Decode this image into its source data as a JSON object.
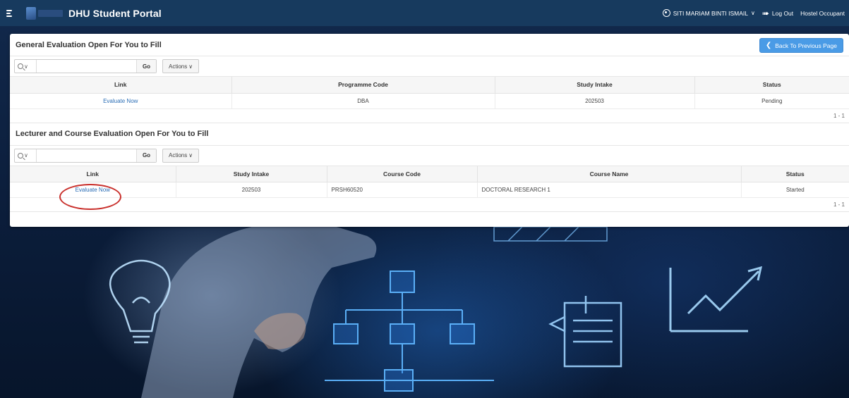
{
  "topbar": {
    "title": "DHU Student Portal",
    "user_name": "SITI MARIAM BINTI ISMAIL",
    "logout_label": "Log Out",
    "hostel_label": "Hostel Occupant",
    "bg_color": "#173a5e"
  },
  "general": {
    "title": "General Evaluation Open For You to Fill",
    "back_button": "Back To Previous Page",
    "go_label": "Go",
    "actions_label": "Actions",
    "columns": [
      "Link",
      "Programme Code",
      "Study Intake",
      "Status"
    ],
    "rows": [
      {
        "link": "Evaluate Now",
        "programme_code": "DBA",
        "study_intake": "202503",
        "status": "Pending"
      }
    ],
    "pagination": "1 - 1"
  },
  "lecturer": {
    "title": "Lecturer and Course Evaluation Open For You to Fill",
    "go_label": "Go",
    "actions_label": "Actions",
    "columns": [
      "Link",
      "Study Intake",
      "Course Code",
      "Course Name",
      "Status"
    ],
    "rows": [
      {
        "link": "Evaluate Now",
        "study_intake": "202503",
        "course_code": "PRSH60520",
        "course_name": "DOCTORAL RESEARCH 1",
        "status": "Started"
      }
    ],
    "pagination": "1 - 1"
  },
  "icons": {
    "menu": "hamburger-icon",
    "user": "user-circle-icon",
    "logout": "logout-icon",
    "search": "search-icon",
    "back": "arrow-left-icon"
  },
  "colors": {
    "accent": "#4a9be6",
    "link": "#2a6db5",
    "annotation": "#c9302c"
  }
}
